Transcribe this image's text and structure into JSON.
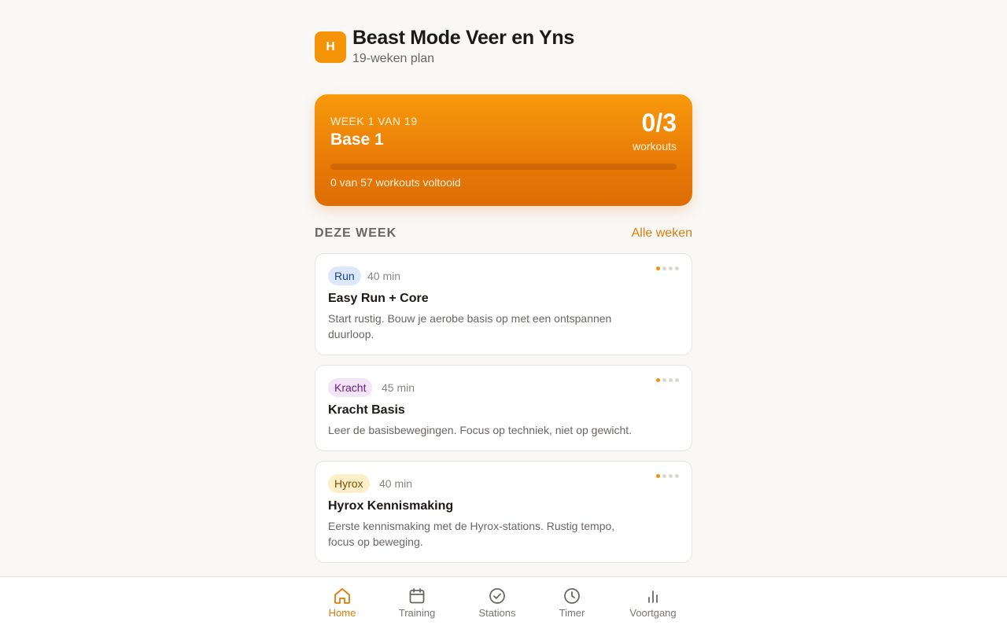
{
  "header": {
    "avatar_letter": "H",
    "title": "Beast Mode Veer en Yns",
    "subtitle": "19-weken plan"
  },
  "hero": {
    "week_label": "WEEK 1 VAN 19",
    "phase": "Base 1",
    "count": "0/3",
    "count_unit": "workouts",
    "progress_fraction": 0,
    "caption": "0 van 57 workouts voltooid"
  },
  "section": {
    "title": "DEZE WEEK",
    "link": "Alle weken"
  },
  "workouts": [
    {
      "tag": "Run",
      "tag_color": "#1f3f8f",
      "tag_bg": "#dde9fb",
      "duration": "40 min",
      "title": "Easy Run + Core",
      "description": "Start rustig. Bouw je aerobe basis op met een ontspannen duurloop.",
      "intensity": 1,
      "intensity_max": 4
    },
    {
      "tag": "Kracht",
      "tag_color": "#6b1f86",
      "tag_bg": "#f3e4f8",
      "duration": "45 min",
      "title": "Kracht Basis",
      "description": "Leer de basisbewegingen. Focus op techniek, niet op gewicht.",
      "intensity": 1,
      "intensity_max": 4
    },
    {
      "tag": "Hyrox",
      "tag_color": "#7a4a06",
      "tag_bg": "#fdf0c8",
      "duration": "40 min",
      "title": "Hyrox Kennismaking",
      "description": "Eerste kennismaking met de Hyrox-stations. Rustig tempo, focus op beweging.",
      "intensity": 1,
      "intensity_max": 4
    }
  ],
  "nav": {
    "items": [
      {
        "label": "Home",
        "icon": "home-icon",
        "active": true
      },
      {
        "label": "Training",
        "icon": "calendar-icon",
        "active": false
      },
      {
        "label": "Stations",
        "icon": "check-circle-icon",
        "active": false
      },
      {
        "label": "Timer",
        "icon": "clock-icon",
        "active": false
      },
      {
        "label": "Voortgang",
        "icon": "bar-chart-icon",
        "active": false
      }
    ]
  },
  "colors": {
    "accent": "#f59306",
    "accent_text": "#e07b07",
    "background": "#f9f8f6"
  }
}
